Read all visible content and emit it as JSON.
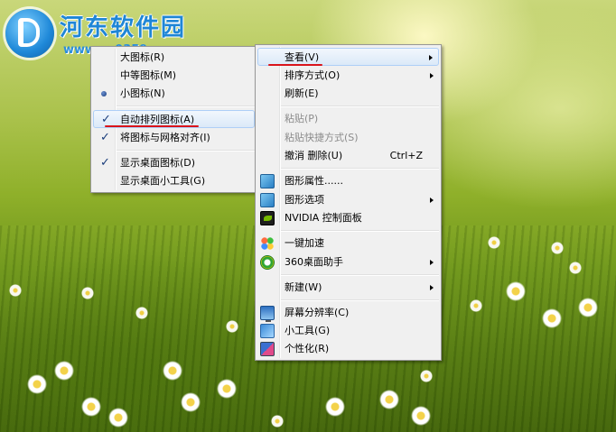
{
  "watermark": {
    "title": "河东软件园",
    "url": "www.pc0359.cn"
  },
  "left_menu": {
    "items": [
      {
        "label": "大图标(R)",
        "check": "",
        "disabled": false
      },
      {
        "label": "中等图标(M)",
        "check": "",
        "disabled": false
      },
      {
        "label": "小图标(N)",
        "check": "dot",
        "disabled": false
      },
      {
        "label": "自动排列图标(A)",
        "check": "check",
        "disabled": false
      },
      {
        "label": "将图标与网格对齐(I)",
        "check": "check",
        "disabled": false
      },
      {
        "label": "显示桌面图标(D)",
        "check": "check",
        "disabled": false
      },
      {
        "label": "显示桌面小工具(G)",
        "check": "",
        "disabled": false
      }
    ]
  },
  "right_menu": {
    "items": [
      {
        "label": "查看(V)",
        "submenu": true,
        "highlight": true
      },
      {
        "label": "排序方式(O)",
        "submenu": true
      },
      {
        "label": "刷新(E)"
      },
      {
        "label": "粘贴(P)",
        "disabled": true
      },
      {
        "label": "粘贴快捷方式(S)",
        "disabled": true
      },
      {
        "label": "撤消 删除(U)",
        "shortcut": "Ctrl+Z"
      },
      {
        "label": "图形属性......",
        "icon": "intel-graphics-icon"
      },
      {
        "label": "图形选项",
        "icon": "intel-graphics-icon",
        "submenu": true
      },
      {
        "label": "NVIDIA 控制面板",
        "icon": "nvidia-icon"
      },
      {
        "label": "一键加速",
        "icon": "speedup-icon"
      },
      {
        "label": "360桌面助手",
        "icon": "360-desktop-icon",
        "submenu": true
      },
      {
        "label": "新建(W)",
        "submenu": true
      },
      {
        "label": "屏幕分辨率(C)",
        "icon": "display-resolution-icon"
      },
      {
        "label": "小工具(G)",
        "icon": "gadgets-icon"
      },
      {
        "label": "个性化(R)",
        "icon": "personalize-icon"
      }
    ]
  },
  "colors": {
    "menu_bg": "#f0f0f0",
    "highlight_border": "#aecff7",
    "annotation_red": "#d9141b",
    "check_color": "#1a3d7c"
  }
}
